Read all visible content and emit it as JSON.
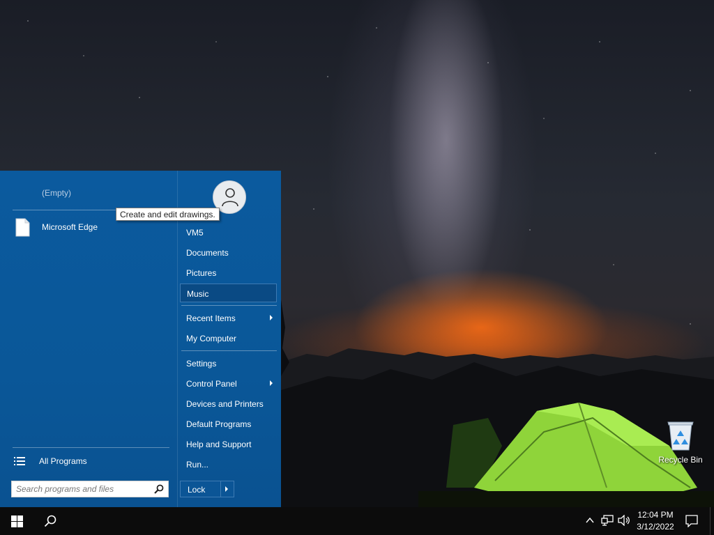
{
  "start_menu": {
    "left": {
      "empty_label": "(Empty)",
      "programs": [
        {
          "label": "Microsoft Edge",
          "icon": "document-icon"
        }
      ],
      "all_programs_label": "All Programs",
      "search_placeholder": "Search programs and files"
    },
    "right": {
      "items": [
        {
          "label": "VM5"
        },
        {
          "label": "Documents"
        },
        {
          "label": "Pictures"
        },
        {
          "label": "Music",
          "selected": true
        },
        {
          "label": "Recent Items",
          "submenu": true
        },
        {
          "label": "My Computer"
        },
        {
          "label": "Settings"
        },
        {
          "label": "Control Panel",
          "submenu": true
        },
        {
          "label": "Devices and Printers"
        },
        {
          "label": "Default Programs"
        },
        {
          "label": "Help and Support"
        },
        {
          "label": "Run..."
        }
      ],
      "lock_label": "Lock"
    },
    "tooltip": "Create and edit drawings."
  },
  "desktop": {
    "icons": [
      {
        "label": "Recycle Bin",
        "icon": "recycle-bin-icon"
      }
    ]
  },
  "taskbar": {
    "clock_time": "12:04 PM",
    "clock_date": "3/12/2022",
    "tray_icons": [
      "chevron-up-icon",
      "network-icon",
      "volume-icon",
      "notification-icon"
    ]
  },
  "colors": {
    "start_menu_bg": "#0b5a9e",
    "selected_item_bg": "#0a4a84",
    "taskbar_bg": "#0c0c0c"
  }
}
